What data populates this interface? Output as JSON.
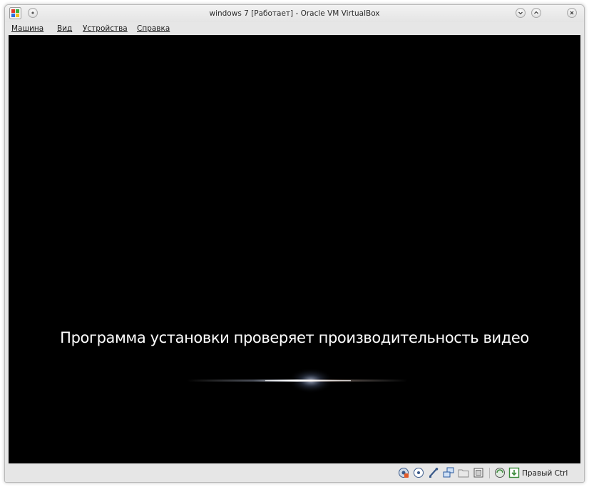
{
  "window": {
    "title": "windows 7 [Работает] - Oracle VM VirtualBox"
  },
  "menu": {
    "items": [
      {
        "label": "Машина"
      },
      {
        "label": "Вид"
      },
      {
        "label": "Устройства"
      },
      {
        "label": "Справка"
      }
    ]
  },
  "guest": {
    "message": "Программа установки проверяет производительность видео",
    "background_color": "#000000",
    "text_color": "#ffffff"
  },
  "statusbar": {
    "icons": [
      "hard-disk-icon",
      "optical-drive-icon",
      "usb-icon",
      "network-icon",
      "shared-folders-icon",
      "video-capture-icon",
      "virtualization-icon",
      "mouse-integration-icon"
    ],
    "host_key": "Правый Ctrl"
  }
}
